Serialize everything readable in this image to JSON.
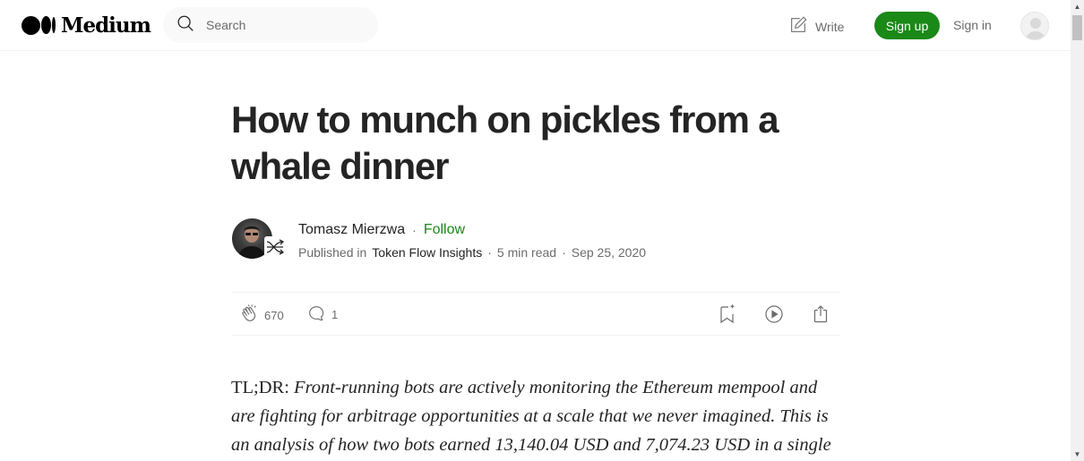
{
  "header": {
    "logo_text": "Medium",
    "search": {
      "placeholder": "Search"
    },
    "write_label": "Write",
    "signup_label": "Sign up",
    "signin_label": "Sign in",
    "accent_color": "#1a8917"
  },
  "article": {
    "title": "How to munch on pickles from a whale dinner",
    "author": {
      "name": "Tomasz Mierzwa",
      "follow_label": "Follow"
    },
    "meta": {
      "published_in_label": "Published in",
      "publication": "Token Flow Insights",
      "read_time": "5 min read",
      "date": "Sep 25, 2020"
    },
    "actions": {
      "claps": "670",
      "responses": "1",
      "icons": [
        "clap-icon",
        "response-icon",
        "bookmark-icon",
        "listen-icon",
        "share-icon"
      ]
    },
    "body": {
      "lead": "TL;DR:",
      "text": "Front-running bots are actively monitoring the Ethereum mempool and are fighting for arbitrage opportunities at a scale that we never imagined. This is an analysis of how two bots earned 13,140.04 USD and 7,074.23 USD in a single"
    }
  }
}
